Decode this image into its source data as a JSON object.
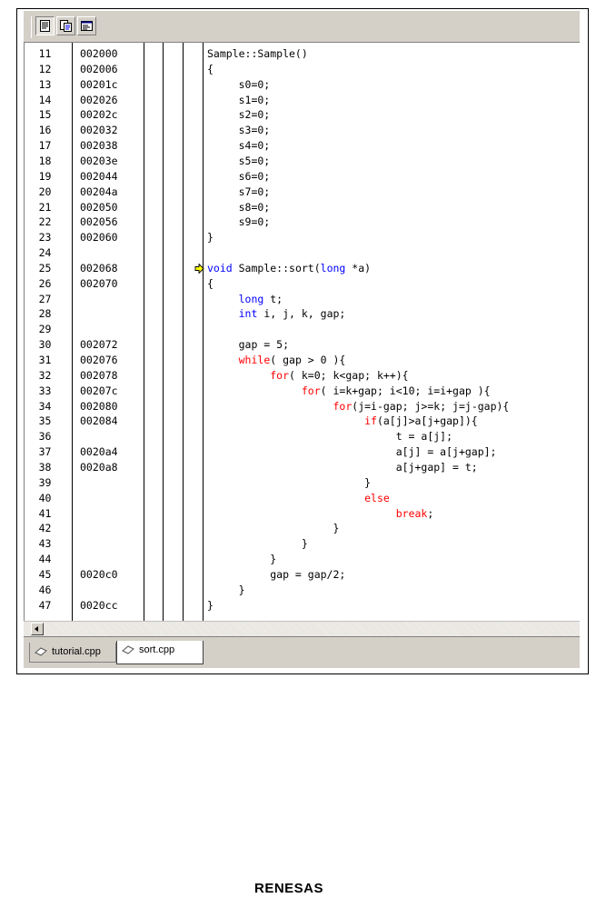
{
  "toolbar": {
    "buttons": [
      {
        "icon": "source-view-icon",
        "active": true
      },
      {
        "icon": "mixed-view-icon",
        "active": false
      },
      {
        "icon": "disassembly-view-icon",
        "active": false
      }
    ]
  },
  "editor": {
    "current_line": 25,
    "lines": [
      {
        "ln": "11",
        "addr": "002000",
        "code": [
          {
            "t": "Sample::Sample()"
          }
        ]
      },
      {
        "ln": "12",
        "addr": "002006",
        "code": [
          {
            "t": "{"
          }
        ]
      },
      {
        "ln": "13",
        "addr": "00201c",
        "code": [
          {
            "t": "     s0=0;"
          }
        ]
      },
      {
        "ln": "14",
        "addr": "002026",
        "code": [
          {
            "t": "     s1=0;"
          }
        ]
      },
      {
        "ln": "15",
        "addr": "00202c",
        "code": [
          {
            "t": "     s2=0;"
          }
        ]
      },
      {
        "ln": "16",
        "addr": "002032",
        "code": [
          {
            "t": "     s3=0;"
          }
        ]
      },
      {
        "ln": "17",
        "addr": "002038",
        "code": [
          {
            "t": "     s4=0;"
          }
        ]
      },
      {
        "ln": "18",
        "addr": "00203e",
        "code": [
          {
            "t": "     s5=0;"
          }
        ]
      },
      {
        "ln": "19",
        "addr": "002044",
        "code": [
          {
            "t": "     s6=0;"
          }
        ]
      },
      {
        "ln": "20",
        "addr": "00204a",
        "code": [
          {
            "t": "     s7=0;"
          }
        ]
      },
      {
        "ln": "21",
        "addr": "002050",
        "code": [
          {
            "t": "     s8=0;"
          }
        ]
      },
      {
        "ln": "22",
        "addr": "002056",
        "code": [
          {
            "t": "     s9=0;"
          }
        ]
      },
      {
        "ln": "23",
        "addr": "002060",
        "code": [
          {
            "t": "}"
          }
        ]
      },
      {
        "ln": "24",
        "addr": "",
        "code": []
      },
      {
        "ln": "25",
        "addr": "002068",
        "code": [
          {
            "t": "void",
            "c": "kw"
          },
          {
            "t": " Sample::sort("
          },
          {
            "t": "long",
            "c": "kw"
          },
          {
            "t": " *a)"
          }
        ]
      },
      {
        "ln": "26",
        "addr": "002070",
        "code": [
          {
            "t": "{"
          }
        ]
      },
      {
        "ln": "27",
        "addr": "",
        "code": [
          {
            "t": "     "
          },
          {
            "t": "long",
            "c": "kw"
          },
          {
            "t": " t;"
          }
        ]
      },
      {
        "ln": "28",
        "addr": "",
        "code": [
          {
            "t": "     "
          },
          {
            "t": "int",
            "c": "kw"
          },
          {
            "t": " i, j, k, gap;"
          }
        ]
      },
      {
        "ln": "29",
        "addr": "",
        "code": []
      },
      {
        "ln": "30",
        "addr": "002072",
        "code": [
          {
            "t": "     gap = 5;"
          }
        ]
      },
      {
        "ln": "31",
        "addr": "002076",
        "code": [
          {
            "t": "     "
          },
          {
            "t": "while",
            "c": "kr"
          },
          {
            "t": "( gap > 0 ){"
          }
        ]
      },
      {
        "ln": "32",
        "addr": "002078",
        "code": [
          {
            "t": "          "
          },
          {
            "t": "for",
            "c": "kr"
          },
          {
            "t": "( k=0; k<gap; k++){"
          }
        ]
      },
      {
        "ln": "33",
        "addr": "00207c",
        "code": [
          {
            "t": "               "
          },
          {
            "t": "for",
            "c": "kr"
          },
          {
            "t": "( i=k+gap; i<10; i=i+gap ){"
          }
        ]
      },
      {
        "ln": "34",
        "addr": "002080",
        "code": [
          {
            "t": "                    "
          },
          {
            "t": "for",
            "c": "kr"
          },
          {
            "t": "(j=i-gap; j>=k; j=j-gap){"
          }
        ]
      },
      {
        "ln": "35",
        "addr": "002084",
        "code": [
          {
            "t": "                         "
          },
          {
            "t": "if",
            "c": "kr"
          },
          {
            "t": "(a[j]>a[j+gap]){"
          }
        ]
      },
      {
        "ln": "36",
        "addr": "",
        "code": [
          {
            "t": "                              t = a[j];"
          }
        ]
      },
      {
        "ln": "37",
        "addr": "0020a4",
        "code": [
          {
            "t": "                              a[j] = a[j+gap];"
          }
        ]
      },
      {
        "ln": "38",
        "addr": "0020a8",
        "code": [
          {
            "t": "                              a[j+gap] = t;"
          }
        ]
      },
      {
        "ln": "39",
        "addr": "",
        "code": [
          {
            "t": "                         }"
          }
        ]
      },
      {
        "ln": "40",
        "addr": "",
        "code": [
          {
            "t": "                         "
          },
          {
            "t": "else",
            "c": "kr"
          }
        ]
      },
      {
        "ln": "41",
        "addr": "",
        "code": [
          {
            "t": "                              "
          },
          {
            "t": "break",
            "c": "kr"
          },
          {
            "t": ";"
          }
        ]
      },
      {
        "ln": "42",
        "addr": "",
        "code": [
          {
            "t": "                    }"
          }
        ]
      },
      {
        "ln": "43",
        "addr": "",
        "code": [
          {
            "t": "               }"
          }
        ]
      },
      {
        "ln": "44",
        "addr": "",
        "code": [
          {
            "t": "          }"
          }
        ]
      },
      {
        "ln": "45",
        "addr": "0020c0",
        "code": [
          {
            "t": "          gap = gap/2;"
          }
        ]
      },
      {
        "ln": "46",
        "addr": "",
        "code": [
          {
            "t": "     }"
          }
        ]
      },
      {
        "ln": "47",
        "addr": "0020cc",
        "code": [
          {
            "t": "}"
          }
        ]
      }
    ]
  },
  "tabs": [
    {
      "label": "tutorial.cpp",
      "active": false
    },
    {
      "label": "sort.cpp",
      "active": true
    }
  ],
  "footer": {
    "logo": "RENESAS"
  }
}
